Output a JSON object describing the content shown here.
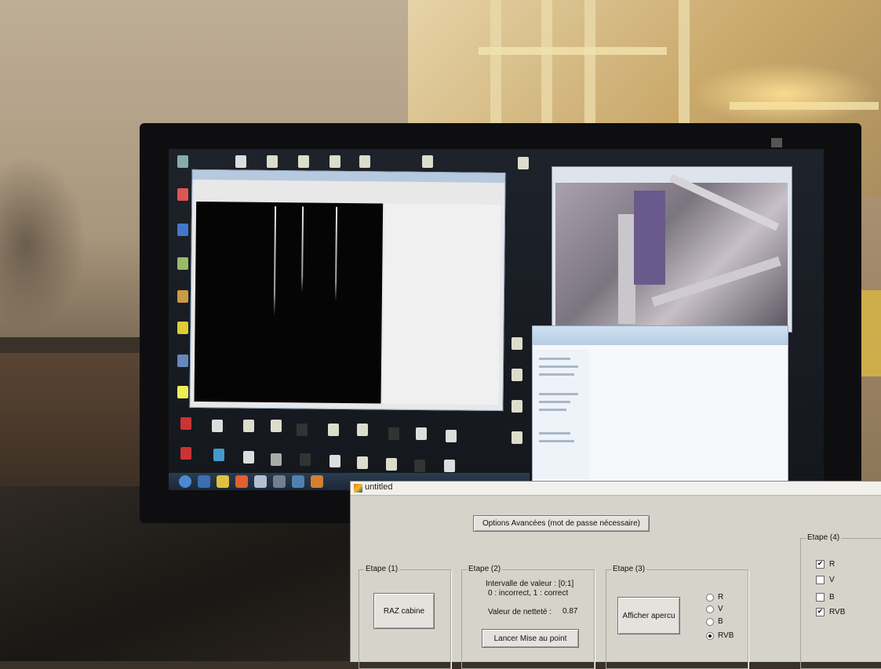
{
  "dialog": {
    "title": "untitled",
    "advanced_button": "Options Avancées (mot de passe nécessaire)",
    "step1": {
      "label": "Etape (1)",
      "button": "RAZ cabine"
    },
    "step2": {
      "label": "Etape (2)",
      "interval_line1": "Intervalle de valeur : [0:1]",
      "interval_line2": "0 : incorrect, 1 : correct",
      "sharpness_label": "Valeur de netteté :",
      "sharpness_value": "0.87",
      "button": "Lancer Mise au point"
    },
    "step3": {
      "label": "Etape (3)",
      "button": "Afficher apercu",
      "channels": [
        {
          "label": "R",
          "selected": false
        },
        {
          "label": "V",
          "selected": false
        },
        {
          "label": "B",
          "selected": false
        },
        {
          "label": "RVB",
          "selected": true
        }
      ]
    },
    "step4": {
      "label": "Etape (4)",
      "checks": [
        {
          "label": "R",
          "checked": true,
          "mark": "✔"
        },
        {
          "label": "V",
          "checked": false,
          "mark": ""
        },
        {
          "label": "B",
          "checked": false,
          "mark": ""
        },
        {
          "label": "RVB",
          "checked": true,
          "mark": "✔"
        }
      ]
    }
  }
}
